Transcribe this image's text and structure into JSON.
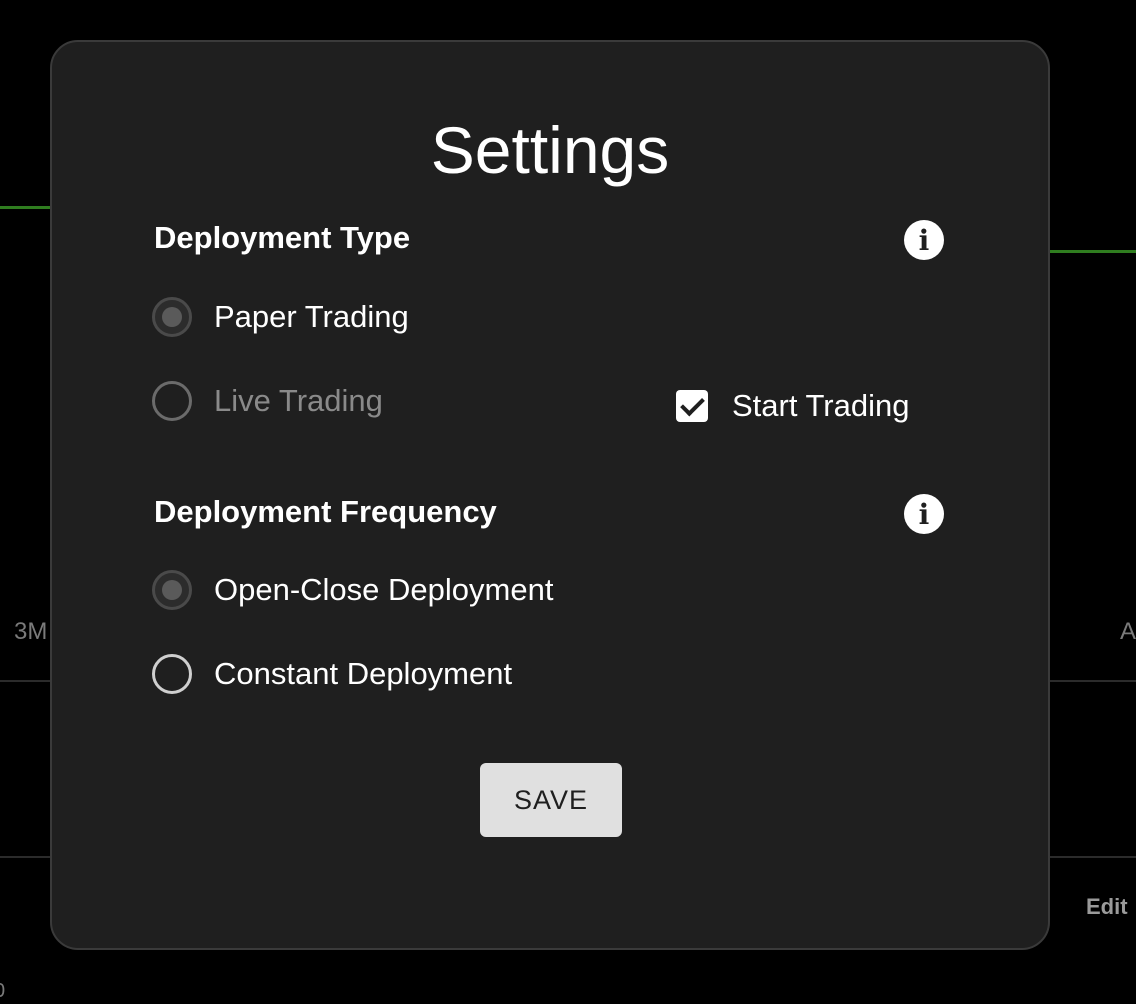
{
  "background": {
    "left_partial_text": "3M",
    "right_partial_text": "A",
    "edit_partial_text": "Edit",
    "bottom_partial_text": "0",
    "accent_line_color": "#2f7d1f"
  },
  "modal": {
    "title": "Settings",
    "deployment_type": {
      "heading": "Deployment Type",
      "info_icon": "info-icon",
      "options": [
        {
          "label": "Paper Trading",
          "selected": true,
          "disabled": false
        },
        {
          "label": "Live Trading",
          "selected": false,
          "disabled": true
        }
      ],
      "start_trading": {
        "label": "Start Trading",
        "checked": true
      }
    },
    "deployment_frequency": {
      "heading": "Deployment Frequency",
      "info_icon": "info-icon",
      "options": [
        {
          "label": "Open-Close Deployment",
          "selected": true
        },
        {
          "label": "Constant Deployment",
          "selected": false
        }
      ]
    },
    "save_label": "SAVE"
  }
}
